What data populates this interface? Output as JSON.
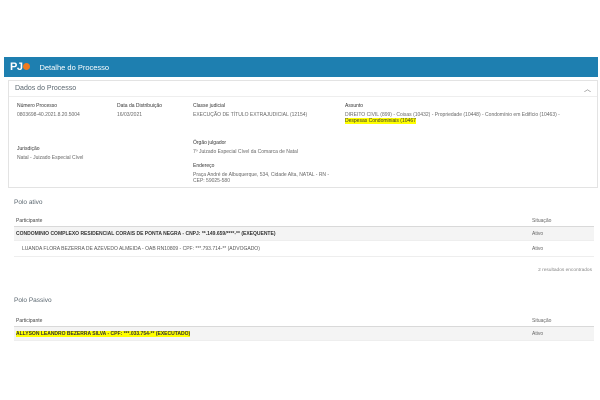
{
  "header": {
    "logo": "PJ",
    "title": "Detalhe do Processo"
  },
  "dados": {
    "title": "Dados do Processo",
    "numero_label": "Número Processo",
    "numero_value": "0803698-40.2021.8.20.5004",
    "data_label": "Data da Distribuição",
    "data_value": "16/03/2021",
    "classe_label": "Classe judicial",
    "classe_value": "EXECUÇÃO DE TÍTULO EXTRAJUDICIAL (12154)",
    "assunto_label": "Assunto",
    "assunto_line1": "DIREITO CIVIL (899) - Coisas (10432) - Propriedade (10448) - Condomínio em Edifício (10463) -",
    "assunto_line2": "Despesas Condominiais (10467",
    "jurisdicao_label": "Jurisdição",
    "jurisdicao_value": "Natal - Juizado Especial Cível",
    "orgao_label": "Órgão julgador",
    "orgao_value": "7º Juizado Especial Cível da Comarca de Natal",
    "endereco_label": "Endereço",
    "endereco_line1": "Praça André de Albuquerque, 534, Cidade Alta, NATAL - RN -",
    "endereco_line2": "CEP: 59025-580"
  },
  "polo_ativo": {
    "title": "Polo ativo",
    "col_participante": "Participante",
    "col_situacao": "Situação",
    "rows": [
      {
        "participante": "CONDOMINIO COMPLEXO RESIDENCIAL CORAIS DE PONTA NEGRA - CNPJ: **.149.659/****-** (EXEQUENTE)",
        "situacao": "Ativo"
      },
      {
        "participante": "LUANDA FLORA BEZERRA DE AZEVEDO ALMEIDA - OAB RN10809 - CPF: ***.793.714-** (ADVOGADO)",
        "situacao": "Ativo"
      }
    ],
    "results": "2 resultados encontrados"
  },
  "polo_passivo": {
    "title": "Polo Passivo",
    "col_participante": "Participante",
    "col_situacao": "Situação",
    "rows": [
      {
        "participante": "ALLYSON LEANDRO BEZERRA SILVA - CPF: ***.033.754-** (EXECUTADO)",
        "situacao": "Ativo"
      }
    ]
  },
  "colors": {
    "topbar": "#1e7fb0",
    "logo_dot": "#f07a1e",
    "highlight": "#ffff00"
  }
}
